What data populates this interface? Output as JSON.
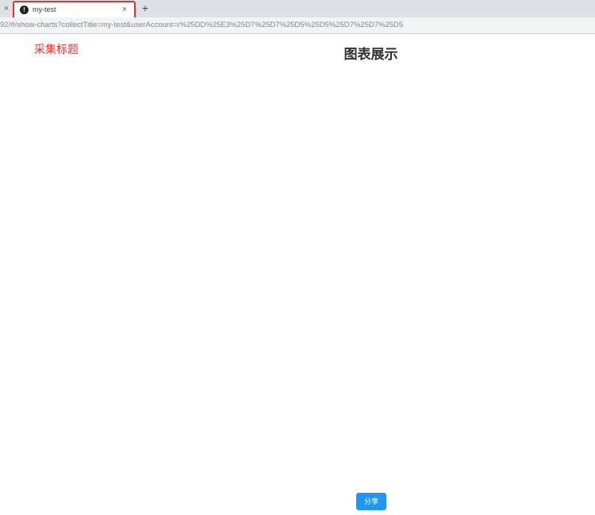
{
  "browser": {
    "prev_tab_close": "×",
    "tab": {
      "title": "my-test",
      "close": "×",
      "favicon": "!"
    },
    "new_tab": "+",
    "url": "92/#/show-charts?collectTitle=my-test&userAccount=r%25DD%25E3%25D7%25D7%25D5%25D5%25D7%25D7%25D5"
  },
  "page": {
    "collect_title": "采集标题",
    "heading": "图表展示",
    "share_button": "分享"
  },
  "colors": {
    "highlight": "#e8312f",
    "button": "#2196f3"
  }
}
